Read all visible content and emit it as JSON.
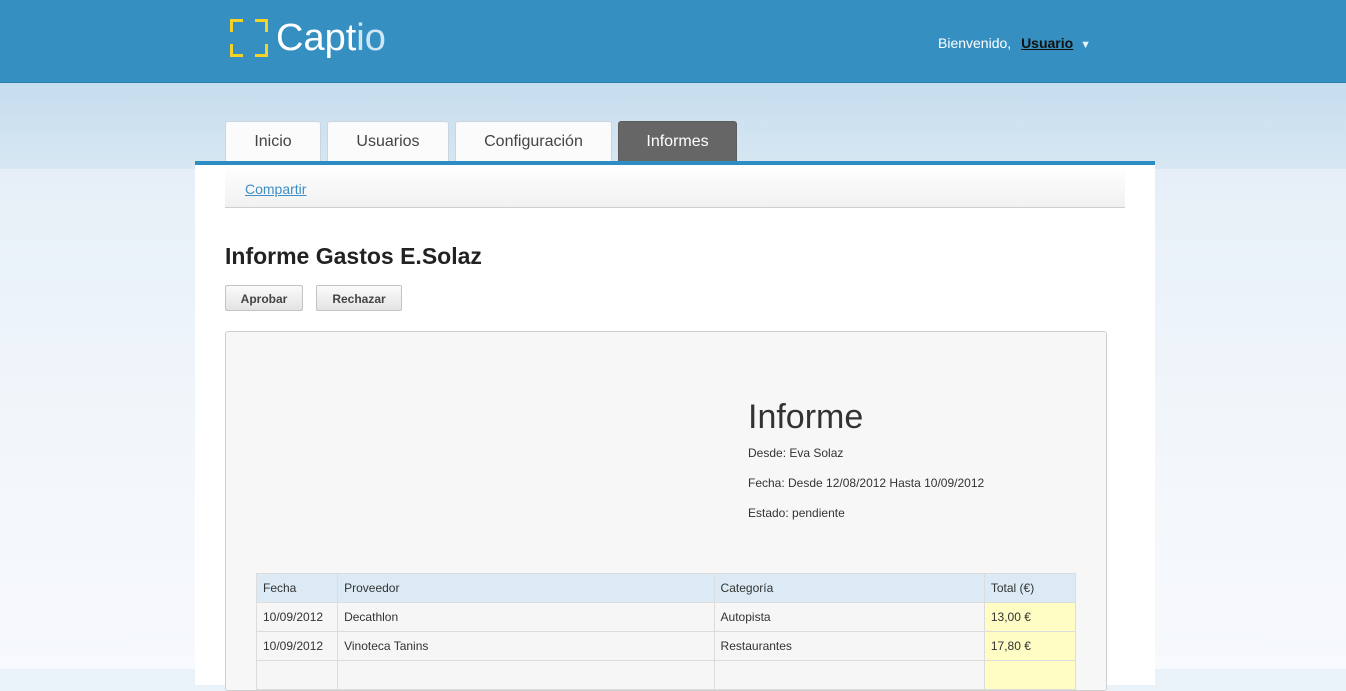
{
  "header": {
    "logo_main": "Capt",
    "logo_light": "io",
    "welcome": "Bienvenido,",
    "user": "Usuario",
    "user_caret": "▼"
  },
  "tabs": [
    {
      "label": "Inicio"
    },
    {
      "label": "Usuarios"
    },
    {
      "label": "Configuración"
    },
    {
      "label": "Informes",
      "active": true
    }
  ],
  "subnav": {
    "share": "Compartir"
  },
  "page": {
    "title": "Informe Gastos E.Solaz",
    "approve": "Aprobar",
    "reject": "Rechazar"
  },
  "report": {
    "title": "Informe",
    "desde": "Desde: Eva Solaz",
    "fecha": "Fecha: Desde 12/08/2012 Hasta 10/09/2012",
    "estado": "Estado: pendiente",
    "columns": [
      "Fecha",
      "Proveedor",
      "Categoría",
      "Total (€)"
    ],
    "rows": [
      {
        "fecha": "10/09/2012",
        "proveedor": "Decathlon",
        "categoria": "Autopista",
        "total": "13,00 €"
      },
      {
        "fecha": "10/09/2012",
        "proveedor": "Vinoteca Tanins",
        "categoria": "Restaurantes",
        "total": "17,80 €"
      },
      {
        "fecha": "",
        "proveedor": "",
        "categoria": "",
        "total": ""
      }
    ]
  },
  "colors": {
    "topbar": "#3590c1",
    "accent": "#2d8cc2",
    "active_tab": "#666666",
    "total_cell": "#fffdc4"
  }
}
